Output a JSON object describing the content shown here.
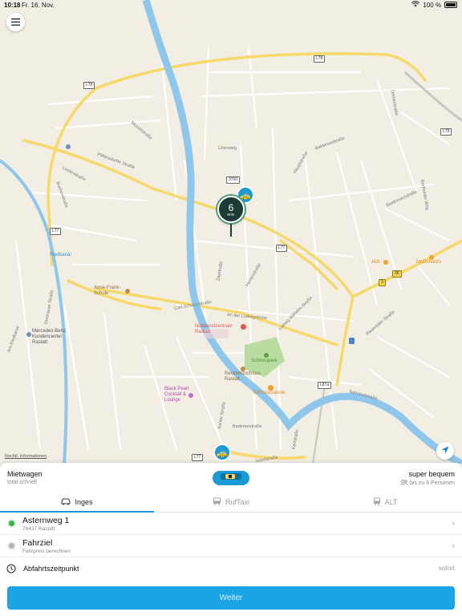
{
  "status_bar": {
    "time": "10:18",
    "date": "Fr. 16. Nov.",
    "battery": "100 %"
  },
  "map": {
    "road_shields": [
      {
        "text": "L78",
        "style": "white"
      },
      {
        "text": "L78",
        "style": "white"
      },
      {
        "text": "L78",
        "style": "white"
      },
      {
        "text": "L77",
        "style": "white"
      },
      {
        "text": "L77",
        "style": "white"
      },
      {
        "text": "L77",
        "style": "white"
      },
      {
        "text": "3760",
        "style": "white"
      },
      {
        "text": "L87a",
        "style": "white"
      },
      {
        "text": "3",
        "style": "yellow"
      },
      {
        "text": "36",
        "style": "yellow"
      }
    ],
    "street_labels": [
      "Plittersdorfer Straße",
      "Lindenstraße",
      "Buchenstraße",
      "Rheinauer Straße",
      "Am Riedkanal",
      "Carl-Schurz-Straße",
      "An der Ludwigsfeste",
      "Kehler Straße",
      "Zaystraße",
      "Ludwig-Wilhelm-Straße",
      "Beethovenstraße",
      "Rauentaler Straße",
      "Josefstraße",
      "Karlstraße",
      "Badenerstraße",
      "Bertholder Weg",
      "Dreherstraße",
      "Baldenaustraße",
      "Bahnhofstraße",
      "Mozartstraße",
      "Herrenstraße",
      "Lilienweg",
      "Hauptstraße"
    ],
    "poi": {
      "riedkanal": "Riedkanal",
      "anne_frank": "Anne-Frank-\nSchule",
      "notdienst": "Notdienstzentrale\nRastatt",
      "schlosspark": "Schlosspark",
      "residenzschloss": "Residenzschloss\nRastatt",
      "schlossgalerie": "SchlossGalerie",
      "mercedes": "Mercedes-Benz\nKundencenter\nRastatt",
      "black_pearl": "Black Pearl\nCocktail &\nLounge",
      "aldi": "Aldi",
      "mcdonalds": "McDonald's"
    },
    "pin": {
      "value": "6",
      "unit": "MIN"
    },
    "legal_text": "Rechtl. Informationen"
  },
  "service": {
    "left_title": "Mietwagen",
    "left_sub": "total schnell",
    "right_title": "super bequem",
    "right_sub": "bis zu 8 Personen",
    "accent": "#1a9ad6"
  },
  "tabs": [
    {
      "label": "Inges",
      "active": true
    },
    {
      "label": "RufTaxi",
      "active": false
    },
    {
      "label": "ALT",
      "active": false
    }
  ],
  "pickup": {
    "title": "Asternweg 1",
    "sub": "76437 Rastatt",
    "color": "#3cb14a"
  },
  "destination": {
    "title": "Fahrziel",
    "sub": "Fahrpreis berechnen",
    "color": "#b5b5b5"
  },
  "departure": {
    "label": "Abfahrtszeitpunkt",
    "value": "sofort"
  },
  "cta": {
    "label": "Weiter",
    "color": "#1ba5e6"
  }
}
